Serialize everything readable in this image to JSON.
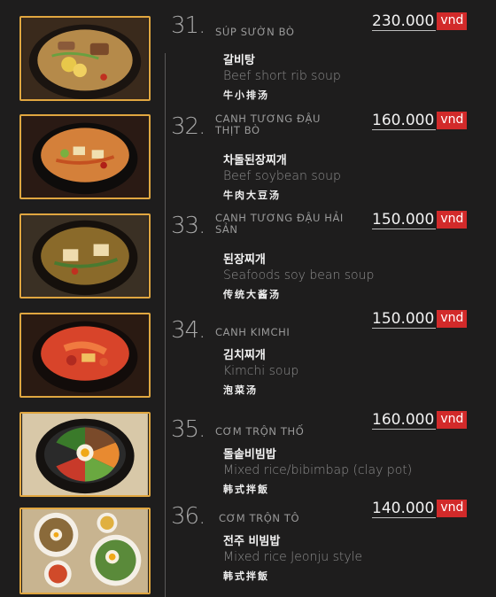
{
  "items": [
    {
      "number": "31.",
      "vn": "SÚP SƯỜN BÒ",
      "price": "230.000",
      "currency": "vnd",
      "ko": "갈비탕",
      "en": "Beef short rib soup",
      "zh": "牛小排汤"
    },
    {
      "number": "32.",
      "vn": "CANH TƯƠNG ĐẬU THỊT BÒ",
      "price": "160.000",
      "currency": "vnd",
      "ko": "차돌된장찌개",
      "en": "Beef soybean soup",
      "zh": "牛肉大豆汤"
    },
    {
      "number": "33.",
      "vn": "CANH TƯƠNG ĐẬU HẢI SẢN",
      "price": "150.000",
      "currency": "vnd",
      "ko": "된장찌개",
      "en": "Seafoods soy bean soup",
      "zh": "传统大酱汤"
    },
    {
      "number": "34.",
      "vn": "CANH KIMCHI",
      "price": "150.000",
      "currency": "vnd",
      "ko": "김치찌개",
      "en": "Kimchi soup",
      "zh": "泡菜汤"
    },
    {
      "number": "35.",
      "vn": "CƠM TRỘN THỐ",
      "price": "160.000",
      "currency": "vnd",
      "ko": "돌솥비빔밥",
      "en": "Mixed rice/bibimbap (clay pot)",
      "zh": "韩式拌飯"
    },
    {
      "number": "36.",
      "vn": "CƠM TRỘN TÔ",
      "price": "140.000",
      "currency": "vnd",
      "ko": "전주 비빔밥",
      "en": "Mixed rice Jeonju style",
      "zh": "韩式拌飯"
    }
  ]
}
